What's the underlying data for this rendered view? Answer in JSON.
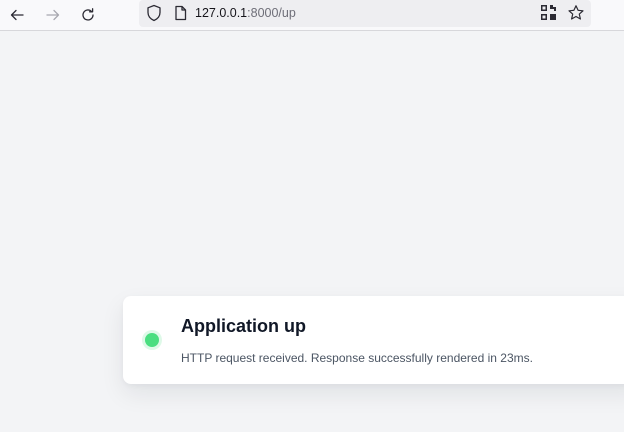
{
  "browser": {
    "url_host": "127.0.0.1",
    "url_rest": ":8000/up",
    "icons": {
      "back": "arrow-left-icon",
      "forward": "arrow-right-icon",
      "reload": "reload-icon",
      "tracking": "shield-icon",
      "page": "page-icon",
      "qr": "qr-code-icon",
      "bookmark": "star-icon"
    }
  },
  "status_card": {
    "title": "Application up",
    "message": "HTTP request received. Response successfully rendered in 23ms.",
    "status_color": "#4ade80"
  }
}
